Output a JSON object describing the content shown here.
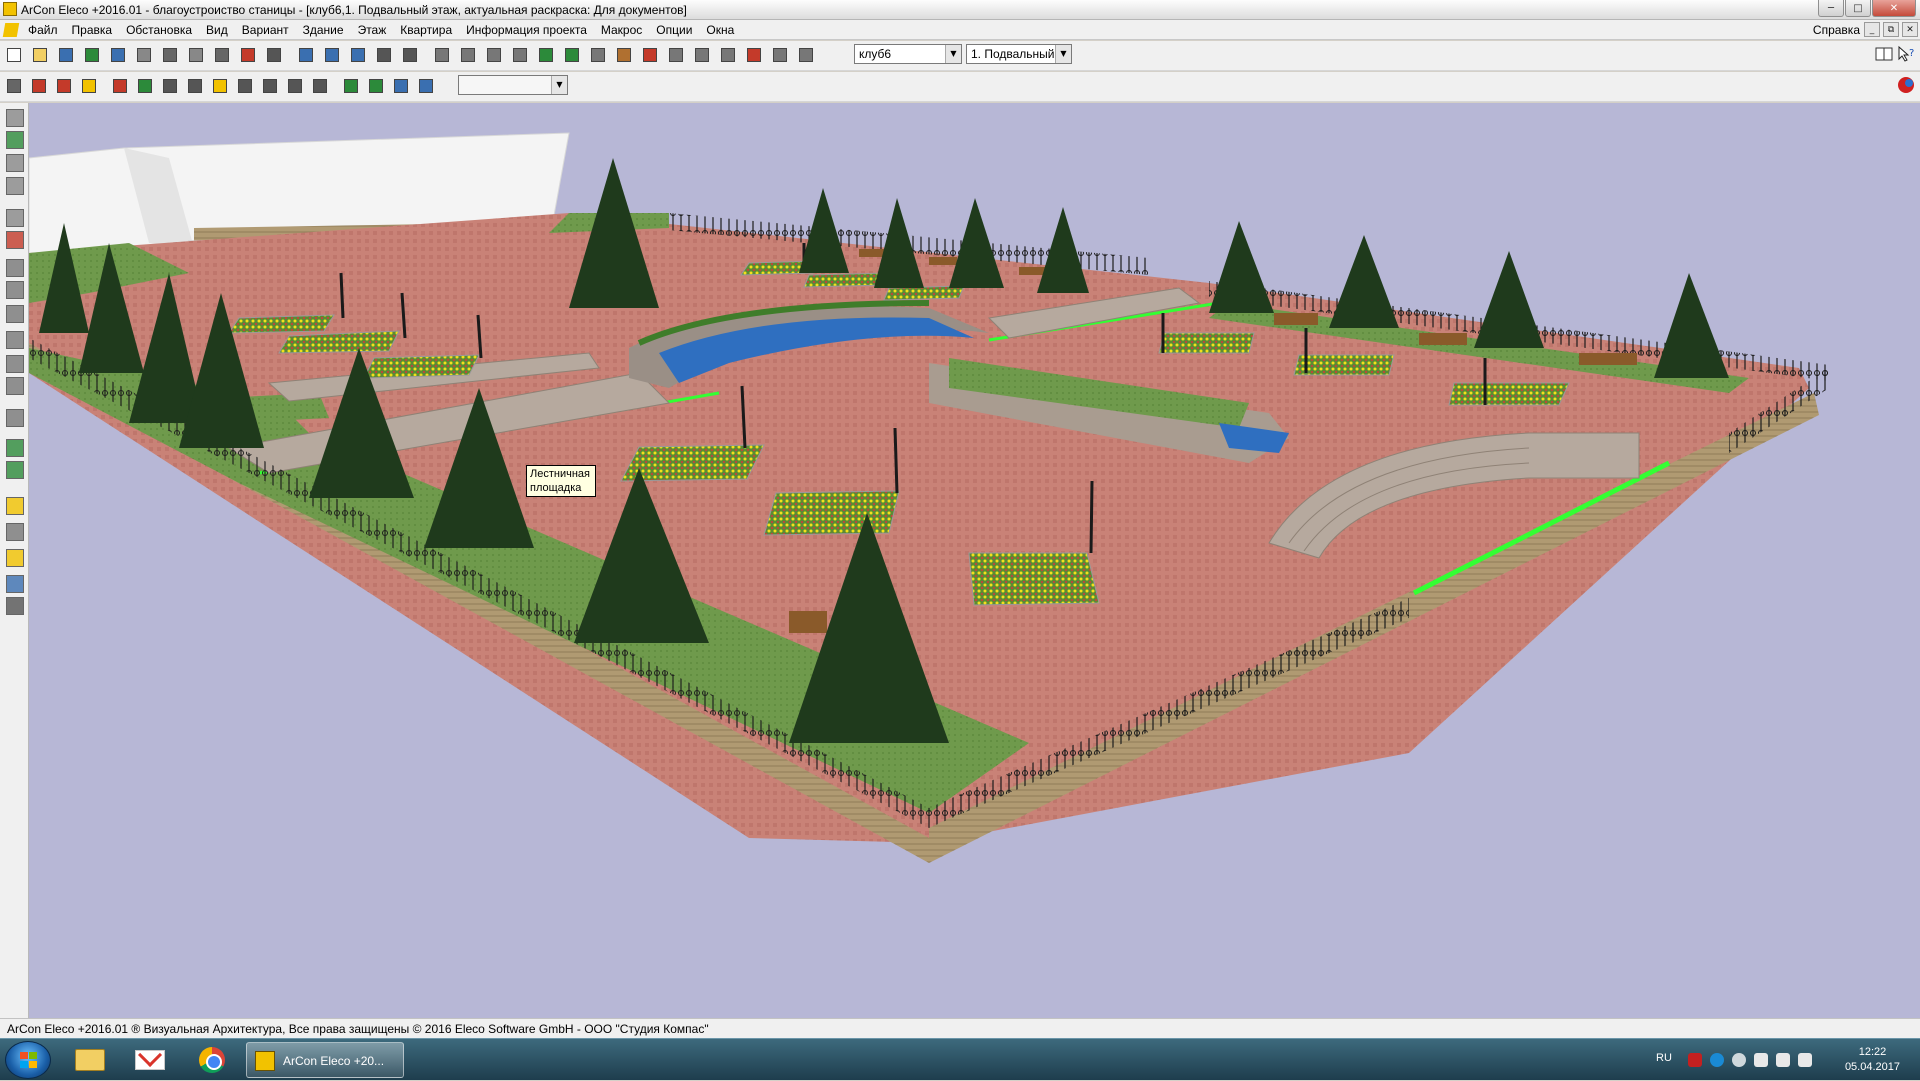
{
  "window": {
    "title": "ArCon Eleco  +2016.01 - благоустроиство станицы - [клуб6,1. Подвальный этаж, актуальная раскраска: Для документов]",
    "controls": [
      "minimize",
      "maximize",
      "close"
    ]
  },
  "menu": {
    "items": [
      "Файл",
      "Правка",
      "Обстановка",
      "Вид",
      "Вариант",
      "Здание",
      "Этаж",
      "Квартира",
      "Информация проекта",
      "Макрос",
      "Опции",
      "Окна"
    ],
    "help": "Справка"
  },
  "toolbar": {
    "building_combo": "клуб6",
    "floor_combo": "1. Подвальный",
    "empty_combo": ""
  },
  "viewport": {
    "background": "#b7b7d6",
    "tooltip_line1": "Лестничная",
    "tooltip_line2": "площадка"
  },
  "statusbar": {
    "text": "ArCon Eleco +2016.01 ® Визуальная Архитектура, Все права защищены © 2016 Eleco Software GmbH - ООО \"Студия Компас\""
  },
  "taskbar": {
    "apps": [
      "windows-explorer",
      "mail",
      "chrome"
    ],
    "active_task": "ArCon Eleco  +20...",
    "language": "RU",
    "time": "12:22",
    "date": "05.04.2017"
  },
  "colors": {
    "pavement": "#c98277",
    "grass": "#6f9a4c",
    "water": "#2f6fc0",
    "tree": "#1f3a1c",
    "fence": "#1a1a1a",
    "accent_line": "#33ff33"
  }
}
